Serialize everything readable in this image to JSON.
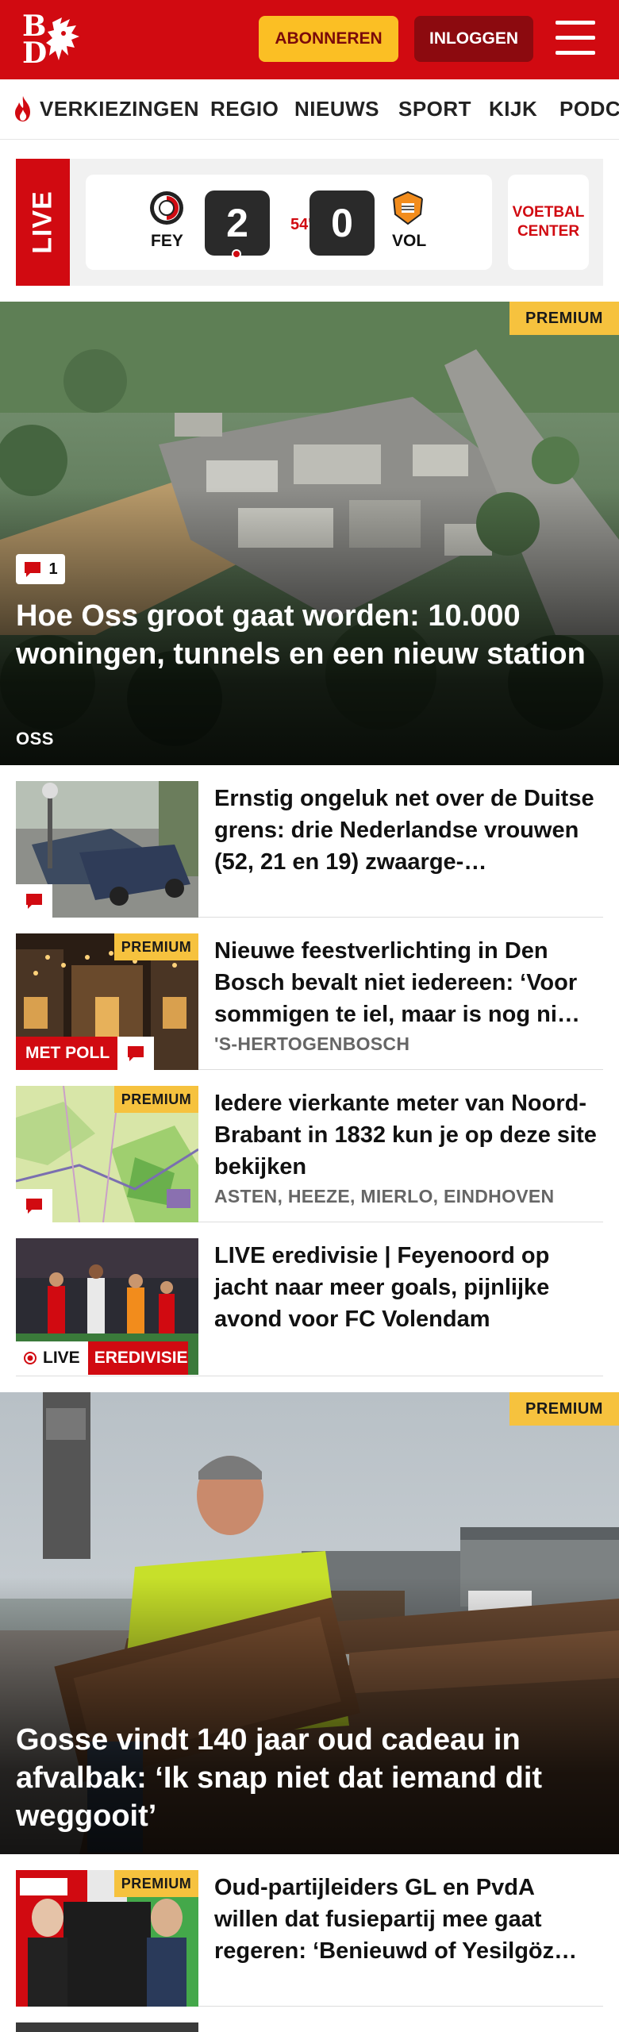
{
  "header": {
    "logo_top": "B",
    "logo_bottom": "D",
    "subscribe_label": "ABONNEREN",
    "login_label": "INLOGGEN"
  },
  "nav": {
    "items": [
      "VERKIEZINGEN",
      "REGIO",
      "NIEUWS",
      "SPORT",
      "KIJK",
      "PODCAST"
    ]
  },
  "live_score": {
    "live_label": "LIVE",
    "home_code": "FEY",
    "away_code": "VOL",
    "home_score": "2",
    "away_score": "0",
    "minute": "54'",
    "center_label_1": "VOETBAL",
    "center_label_2": "CENTER"
  },
  "hero1": {
    "premium": "PREMIUM",
    "comments": "1",
    "title": "Hoe Oss groot gaat worden: 10.000 woningen, tunnels en een nieuw station",
    "location": "OSS"
  },
  "articles": [
    {
      "title": "Ernstig ongeluk net over de Duitse grens: drie Nederlandse vrouwen (52, 21 en 19) zwaarge-…",
      "location": ""
    },
    {
      "premium": "PREMIUM",
      "poll": "MET POLL",
      "title": "Nieuwe feestverlichting in Den Bosch bevalt niet iedereen: ‘Voor sommigen te iel, maar is nog ni…",
      "location": "'S-HERTOGENBOSCH"
    },
    {
      "premium": "PREMIUM",
      "title": "Iedere vierkante meter van Noord-Brabant in 1832 kun je op deze site bekijken",
      "location": "ASTEN, HEEZE, MIERLO, EINDHOVEN"
    },
    {
      "live": "LIVE",
      "category": "EREDIVISIE",
      "title": "LIVE eredivisie | Feyenoord op jacht naar meer goals, pijnlijke avond voor FC Volendam",
      "location": ""
    }
  ],
  "hero2": {
    "premium": "PREMIUM",
    "title": "Gosse vindt 140 jaar oud cadeau in afvalbak: ‘Ik snap niet dat iemand dit weggooit’"
  },
  "article_last": {
    "premium": "PREMIUM",
    "title": "Oud-partijleiders GL en PvdA willen dat fusiepartij mee gaat regeren: ‘Benieuwd of Yesilgöz…"
  },
  "colors": {
    "brand_red": "#d10a11",
    "premium_yellow": "#f6c23e",
    "subscribe_yellow": "#fbbf24"
  }
}
